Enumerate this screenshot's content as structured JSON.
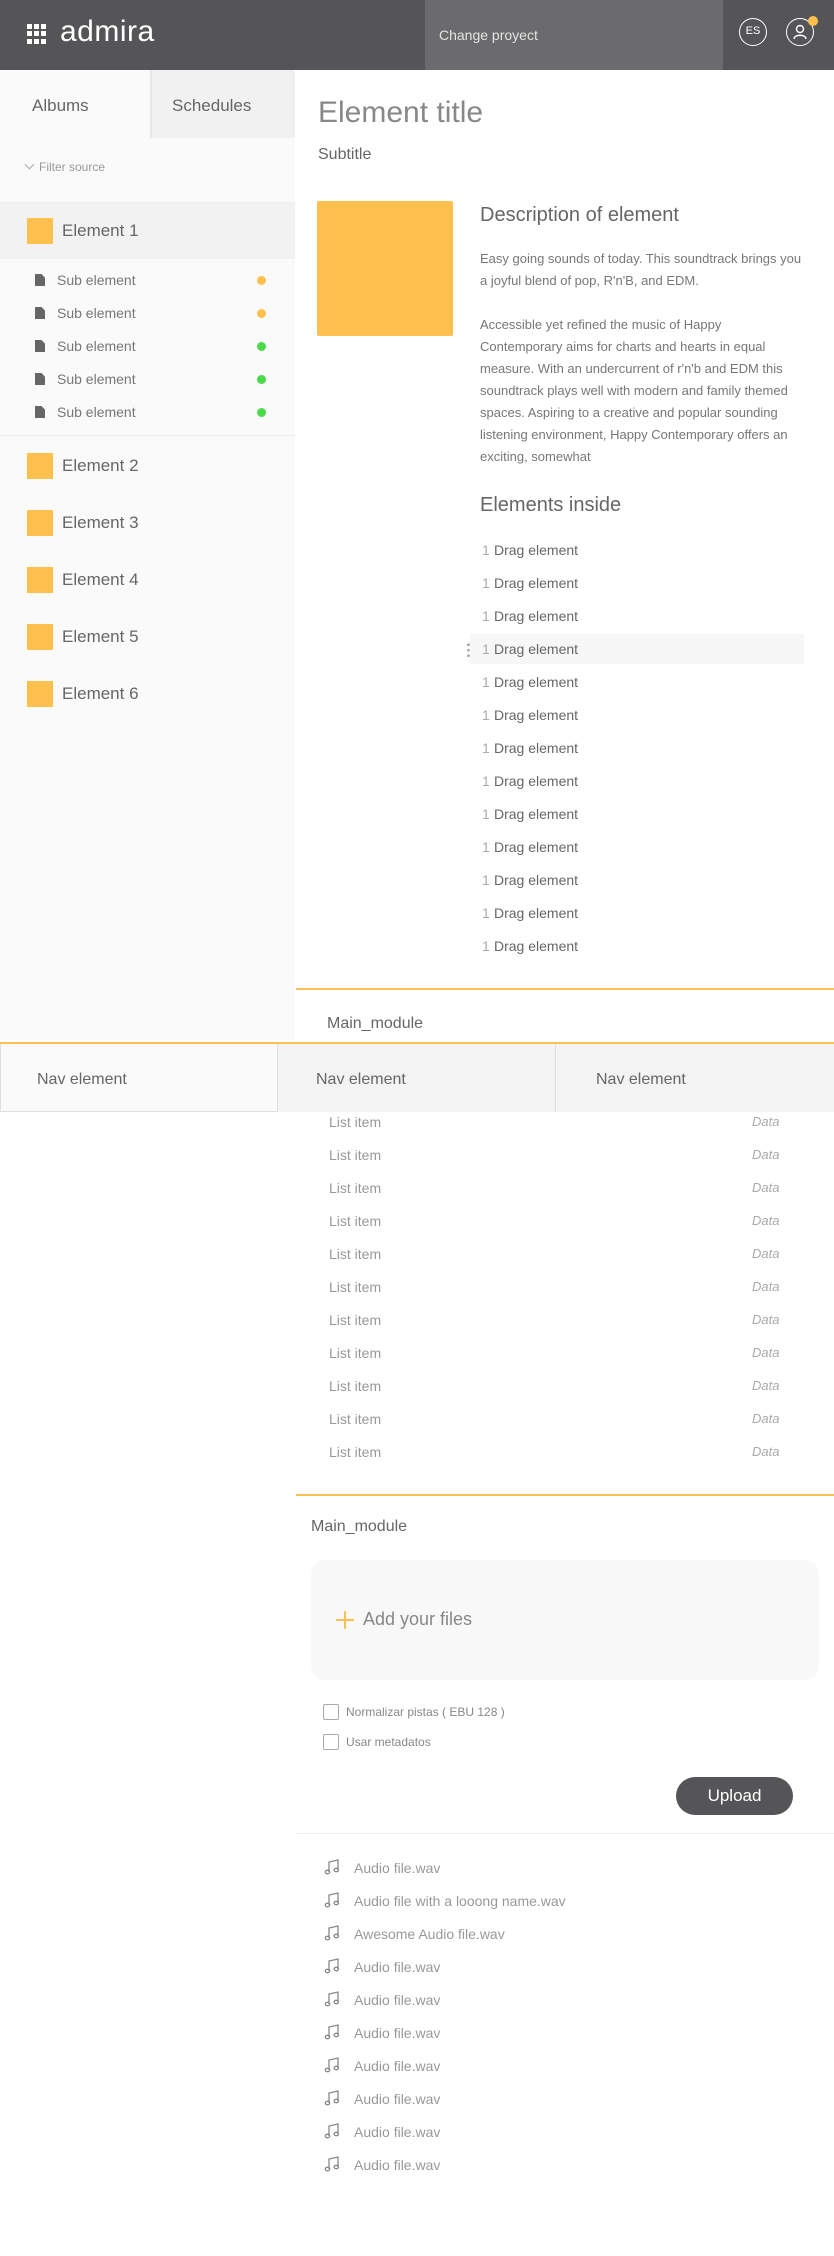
{
  "header": {
    "logo": "admira",
    "change_project": "Change proyect",
    "language": "ES",
    "icons": [
      "apps-grid-icon",
      "user-icon",
      "notification-dot"
    ]
  },
  "sidebar": {
    "tabs": [
      {
        "label": "Albums"
      },
      {
        "label": "Schedules"
      }
    ],
    "filter": "Filter source",
    "elements": [
      {
        "label": "Element 1"
      },
      {
        "label": "Element 2"
      },
      {
        "label": "Element 3"
      },
      {
        "label": "Element 4"
      },
      {
        "label": "Element 5"
      },
      {
        "label": "Element 6"
      }
    ],
    "sub_elements": [
      {
        "label": "Sub element",
        "status": "#ffc04d"
      },
      {
        "label": "Sub element",
        "status": "#ffc04d"
      },
      {
        "label": "Sub element",
        "status": "#4cd94c"
      },
      {
        "label": "Sub element",
        "status": "#4cd94c"
      },
      {
        "label": "Sub element",
        "status": "#4cd94c"
      }
    ]
  },
  "main": {
    "title": "Element title",
    "subtitle": "Subtitle",
    "description_title": "Description of element",
    "description_paragraphs": [
      "Easy going sounds of today. This soundtrack brings you a joyful blend of pop, R'n'B, and EDM.",
      "Accessible yet refined the music of Happy Contemporary aims for charts and hearts in equal measure. With an undercurrent of r'n'b and EDM this soundtrack plays well with modern and family themed spaces. Aspiring to a creative and popular sounding listening environment, Happy Contemporary offers an exciting, somewhat"
    ],
    "elements_inside_title": "Elements inside",
    "drag_elements": [
      {
        "num": "1",
        "label": "Drag element"
      },
      {
        "num": "1",
        "label": "Drag element"
      },
      {
        "num": "1",
        "label": "Drag element"
      },
      {
        "num": "1",
        "label": "Drag element"
      },
      {
        "num": "1",
        "label": "Drag element"
      },
      {
        "num": "1",
        "label": "Drag element"
      },
      {
        "num": "1",
        "label": "Drag element"
      },
      {
        "num": "1",
        "label": "Drag element"
      },
      {
        "num": "1",
        "label": "Drag element"
      },
      {
        "num": "1",
        "label": "Drag element"
      },
      {
        "num": "1",
        "label": "Drag element"
      },
      {
        "num": "1",
        "label": "Drag element"
      },
      {
        "num": "1",
        "label": "Drag element"
      }
    ]
  },
  "module1": {
    "title": "Main_module"
  },
  "nav": {
    "items": [
      {
        "label": "Nav element"
      },
      {
        "label": "Nav element"
      },
      {
        "label": "Nav element"
      }
    ]
  },
  "list": {
    "items": [
      {
        "label": "List item",
        "data": "Data"
      },
      {
        "label": "List item",
        "data": "Data"
      },
      {
        "label": "List item",
        "data": "Data"
      },
      {
        "label": "List item",
        "data": "Data"
      },
      {
        "label": "List item",
        "data": "Data"
      },
      {
        "label": "List item",
        "data": "Data"
      },
      {
        "label": "List item",
        "data": "Data"
      },
      {
        "label": "List item",
        "data": "Data"
      },
      {
        "label": "List item",
        "data": "Data"
      },
      {
        "label": "List item",
        "data": "Data"
      },
      {
        "label": "List item",
        "data": "Data"
      }
    ]
  },
  "module2": {
    "title": "Main_module",
    "add_files": "Add your files",
    "checkboxes": [
      {
        "label": "Normalizar pistas ( EBU 128 )"
      },
      {
        "label": "Usar metadatos"
      }
    ],
    "upload": "Upload",
    "files": [
      {
        "name": "Audio file.wav"
      },
      {
        "name": "Audio file with a looong name.wav"
      },
      {
        "name": "Awesome Audio file.wav"
      },
      {
        "name": "Audio file.wav"
      },
      {
        "name": "Audio file.wav"
      },
      {
        "name": "Audio file.wav"
      },
      {
        "name": "Audio file.wav"
      },
      {
        "name": "Audio file.wav"
      },
      {
        "name": "Audio file.wav"
      },
      {
        "name": "Audio file.wav"
      }
    ]
  },
  "colors": {
    "accent": "#ffc04d",
    "header": "#555558",
    "ok": "#4cd94c"
  }
}
